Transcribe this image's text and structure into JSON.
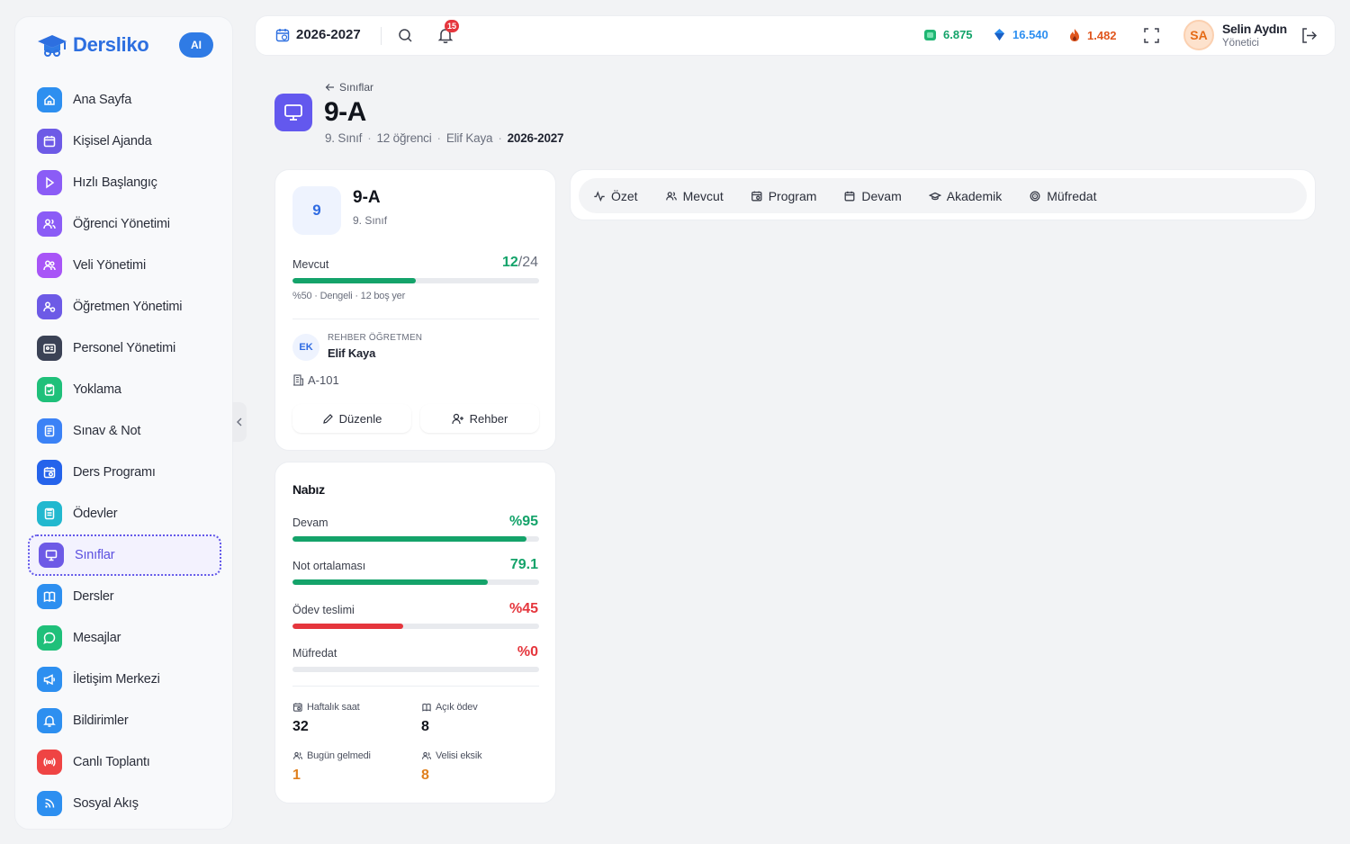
{
  "app": {
    "name": "Dersliko",
    "ai_badge": "AI"
  },
  "sidebar": {
    "items": [
      {
        "label": "Ana Sayfa",
        "icon": "home-icon",
        "color": "#2d8ff0"
      },
      {
        "label": "Kişisel Ajanda",
        "icon": "calendar-icon",
        "color": "#6d5ae6"
      },
      {
        "label": "Hızlı Başlangıç",
        "icon": "play-icon",
        "color": "#8b5cf6"
      },
      {
        "label": "Öğrenci Yönetimi",
        "icon": "users-icon",
        "color": "#8b5cf6"
      },
      {
        "label": "Veli Yönetimi",
        "icon": "user-group-icon",
        "color": "#a855f7"
      },
      {
        "label": "Öğretmen Yönetimi",
        "icon": "teacher-icon",
        "color": "#6d5ae6"
      },
      {
        "label": "Personel Yönetimi",
        "icon": "id-card-icon",
        "color": "#3b4255"
      },
      {
        "label": "Yoklama",
        "icon": "clipboard-check-icon",
        "color": "#1fc07a"
      },
      {
        "label": "Sınav & Not",
        "icon": "exam-icon",
        "color": "#3b82f6"
      },
      {
        "label": "Ders Programı",
        "icon": "schedule-icon",
        "color": "#2563eb"
      },
      {
        "label": "Ödevler",
        "icon": "homework-icon",
        "color": "#22b8cf"
      },
      {
        "label": "Sınıflar",
        "icon": "presentation-icon",
        "color": "#6d5ae6"
      },
      {
        "label": "Dersler",
        "icon": "book-icon",
        "color": "#2d8ff0"
      },
      {
        "label": "Mesajlar",
        "icon": "chat-icon",
        "color": "#1fc07a"
      },
      {
        "label": "İletişim Merkezi",
        "icon": "megaphone-icon",
        "color": "#2d8ff0"
      },
      {
        "label": "Bildirimler",
        "icon": "bell-icon",
        "color": "#2d8ff0"
      },
      {
        "label": "Canlı Toplantı",
        "icon": "broadcast-icon",
        "color": "#ef4444"
      },
      {
        "label": "Sosyal Akış",
        "icon": "rss-icon",
        "color": "#2d8ff0"
      }
    ],
    "active_index": 11
  },
  "topbar": {
    "year": "2026-2027",
    "notif_count": "15",
    "stats": [
      {
        "value": "6.875",
        "icon": "gem-green-icon",
        "color": "#14a36a"
      },
      {
        "value": "16.540",
        "icon": "gem-blue-icon",
        "color": "#2d8ff0"
      },
      {
        "value": "1.482",
        "icon": "fire-icon",
        "color": "#e0561e"
      }
    ],
    "user": {
      "initials": "SA",
      "name": "Selin Aydın",
      "role": "Yönetici"
    }
  },
  "header": {
    "back_label": "Sınıflar",
    "title": "9-A",
    "grade": "9. Sınıf",
    "students": "12 öğrenci",
    "teacher": "Elif Kaya",
    "year": "2026-2027"
  },
  "class_card": {
    "badge": "9",
    "title": "9-A",
    "subtitle": "9. Sınıf",
    "mevcut_label": "Mevcut",
    "mevcut_value": "12",
    "mevcut_sep": "/",
    "mevcut_total": "24",
    "mevcut_fraction": 0.5,
    "mevcut_note": "%50 · Dengeli · 12 boş yer",
    "rehber_initials": "EK",
    "rehber_label": "REHBER ÖĞRETMEN",
    "rehber_name": "Elif Kaya",
    "room": "A-101",
    "edit_label": "Düzenle",
    "rehber_button": "Rehber"
  },
  "pulse": {
    "title": "Nabız",
    "metrics": [
      {
        "label": "Devam",
        "value": "%95",
        "fraction": 0.95,
        "color": "#14a36a"
      },
      {
        "label": "Not ortalaması",
        "value": "79.1",
        "fraction": 0.791,
        "color": "#14a36a"
      },
      {
        "label": "Ödev teslimi",
        "value": "%45",
        "fraction": 0.45,
        "color": "#e5363d"
      },
      {
        "label": "Müfredat",
        "value": "%0",
        "fraction": 0,
        "color": "#e5363d"
      }
    ],
    "stats": [
      {
        "label": "Haftalık saat",
        "value": "32",
        "color": "#11141c"
      },
      {
        "label": "Açık ödev",
        "value": "8",
        "color": "#11141c"
      },
      {
        "label": "Bugün gelmedi",
        "value": "1",
        "color": "#e0801e"
      },
      {
        "label": "Velisi eksik",
        "value": "8",
        "color": "#e0801e"
      }
    ]
  },
  "tabs": [
    {
      "label": "Özet",
      "icon": "activity-icon"
    },
    {
      "label": "Mevcut",
      "icon": "users-icon"
    },
    {
      "label": "Program",
      "icon": "calendar-clock-icon"
    },
    {
      "label": "Devam",
      "icon": "calendar-icon"
    },
    {
      "label": "Akademik",
      "icon": "graduation-cap-icon"
    },
    {
      "label": "Müfredat",
      "icon": "target-icon"
    }
  ]
}
